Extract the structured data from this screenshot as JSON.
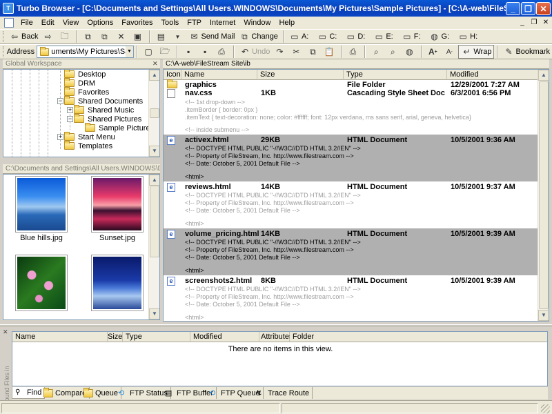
{
  "window": {
    "title": "Turbo Browser - [C:\\Documents and Settings\\All Users.WINDOWS\\Documents\\My Pictures\\Sample Pictures] - [C:\\A-web\\FileStream Site\\ib\\activex.html]",
    "minimize": "_",
    "restore": "❐",
    "close": "✕"
  },
  "menu": {
    "items": [
      "File",
      "Edit",
      "View",
      "Options",
      "Favorites",
      "Tools",
      "FTP",
      "Internet",
      "Window",
      "Help"
    ]
  },
  "toolbar": {
    "back_label": "Back",
    "send_mail_label": "Send Mail",
    "change_label": "Change",
    "drives": [
      "A:",
      "C:",
      "D:",
      "E:",
      "F:",
      "G:",
      "H:"
    ]
  },
  "address": {
    "label": "Address",
    "value": "uments\\My Pictures\\Sample Pictures",
    "undo_label": "Undo",
    "wrap_label": "Wrap",
    "bookmark_label": "Bookmark"
  },
  "workspace": {
    "header": "Global Workspace",
    "tree": [
      {
        "label": "Desktop"
      },
      {
        "label": "DRM"
      },
      {
        "label": "Favorites"
      },
      {
        "label": "Shared Documents"
      },
      {
        "label": "Shared Music"
      },
      {
        "label": "Shared Pictures"
      },
      {
        "label": "Sample Pictures"
      },
      {
        "label": "Start Menu"
      },
      {
        "label": "Templates"
      }
    ]
  },
  "thumbnails": {
    "path": "C:\\Documents and Settings\\All Users.WINDOWS\\Documents\\My Pictures\\Sample Pictures",
    "items": [
      {
        "caption": "Blue hills.jpg"
      },
      {
        "caption": "Sunset.jpg"
      },
      {
        "caption": ""
      },
      {
        "caption": ""
      }
    ]
  },
  "filelist": {
    "path": "C:\\A-web\\FileStream Site\\ib",
    "columns": [
      "Icon",
      "Name",
      "Size",
      "Type",
      "Modified"
    ],
    "rows": [
      {
        "name": "graphics",
        "size": "",
        "type": "File Folder",
        "modified": "12/29/2001 7:27 AM",
        "icon": "folder-icon"
      },
      {
        "name": "nav.css",
        "size": "1KB",
        "type": "Cascading Style Sheet Docum...",
        "modified": "6/3/2001 6:56 PM",
        "icon": "css-file-icon",
        "preview": [
          "<!-- 1st drop-down -->",
          ".itemBorder { border: 0px }",
          ".itemText { text-decoration: none; color: #ffffff; font: 12px verdana, ms sans serif, arial, geneva, helvetica}",
          "",
          "<!-- inside submenu -->"
        ]
      },
      {
        "name": "activex.html",
        "size": "29KB",
        "type": "HTML Document",
        "modified": "10/5/2001 9:36 AM",
        "icon": "html-file-icon",
        "preview": [
          "<!-- DOCTYPE HTML PUBLIC \"-//W3C//DTD HTML 3.2//EN\" -->",
          "<!-- Property of FileStream, Inc.  http://www.filestream.com -->",
          "<!-- Date: October 5, 2001 Default File -->",
          "",
          "<html>"
        ]
      },
      {
        "name": "reviews.html",
        "size": "14KB",
        "type": "HTML Document",
        "modified": "10/5/2001 9:37 AM",
        "icon": "html-file-icon",
        "preview": [
          "<!-- DOCTYPE HTML PUBLIC \"-//W3C//DTD HTML 3.2//EN\" -->",
          "<!-- Property of FileStream, Inc.  http://www.filestream.com -->",
          "<!-- Date: October 5, 2001 Default File -->",
          "",
          "<html>"
        ]
      },
      {
        "name": "volume_pricing.html",
        "size": "14KB",
        "type": "HTML Document",
        "modified": "10/5/2001 9:39 AM",
        "icon": "html-file-icon",
        "preview": [
          "<!-- DOCTYPE HTML PUBLIC \"-//W3C//DTD HTML 3.2//EN\" -->",
          "<!-- Property of FileStream, Inc.  http://www.filestream.com -->",
          "<!-- Date: October 5, 2001 Default File -->",
          "",
          "<html>"
        ]
      },
      {
        "name": "screenshots2.html",
        "size": "8KB",
        "type": "HTML Document",
        "modified": "10/5/2001 9:39 AM",
        "icon": "html-file-icon",
        "preview": [
          "<!-- DOCTYPE HTML PUBLIC \"-//W3C//DTD HTML 3.2//EN\" -->",
          "<!-- Property of FileStream, Inc.  http://www.filestream.com -->",
          "<!-- Date: October 5, 2001 Default File -->",
          "",
          "<html>"
        ]
      }
    ]
  },
  "found": {
    "side_label": "Found Files in",
    "columns": [
      "Name",
      "Size",
      "Type",
      "Modified",
      "Attributes",
      "Folder"
    ],
    "empty_text": "There are no items in this view.",
    "tabs": [
      "Find",
      "Compare",
      "Queue",
      "FTP Status",
      "FTP Buffer",
      "FTP Queue",
      "Trace Route"
    ]
  }
}
